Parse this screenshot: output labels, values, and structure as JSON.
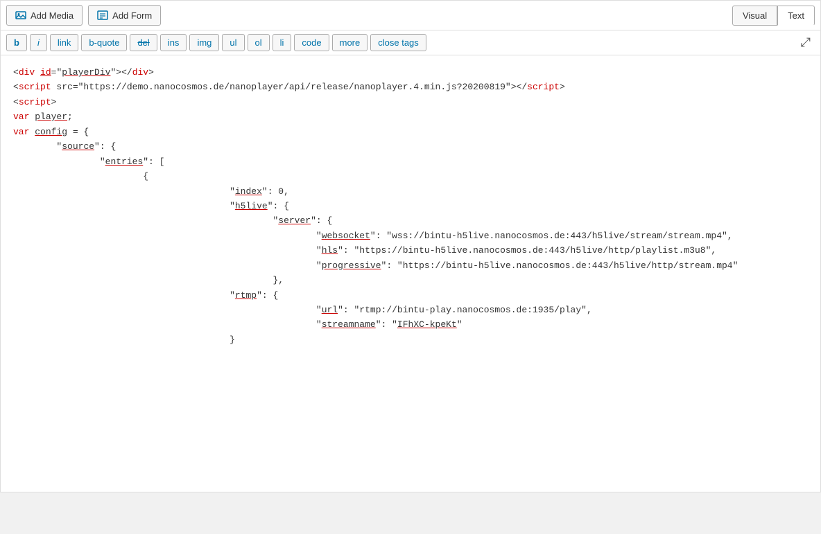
{
  "topToolbar": {
    "addMediaLabel": "Add Media",
    "addFormLabel": "Add Form",
    "visualLabel": "Visual",
    "textLabel": "Text"
  },
  "formatToolbar": {
    "buttons": [
      {
        "label": "b",
        "style": "bold"
      },
      {
        "label": "i",
        "style": "italic"
      },
      {
        "label": "link",
        "style": "normal"
      },
      {
        "label": "b-quote",
        "style": "normal"
      },
      {
        "label": "del",
        "style": "strikethrough"
      },
      {
        "label": "ins",
        "style": "normal"
      },
      {
        "label": "img",
        "style": "normal"
      },
      {
        "label": "ul",
        "style": "normal"
      },
      {
        "label": "ol",
        "style": "normal"
      },
      {
        "label": "li",
        "style": "normal"
      },
      {
        "label": "code",
        "style": "normal"
      },
      {
        "label": "more",
        "style": "normal"
      },
      {
        "label": "close tags",
        "style": "normal"
      }
    ],
    "expandIcon": "⤢"
  },
  "codeContent": {
    "line1": "<div id=\"playerDiv\"></div>",
    "line2": "<script src=\"https://demo.nanocosmos.de/nanoplayer/api/release/nanoplayer.4.min.js?20200819\"><\\/script>",
    "line3": "<script>",
    "line4": "var player;",
    "line5": "var config = {",
    "line6": "        \"source\": {",
    "line7": "                \"entries\": [",
    "line8": "                        {",
    "line9": "                                        \"index\": 0,",
    "line10": "                                        \"h5live\": {",
    "line11": "                                                \"server\": {",
    "line12a": "                                                        \"websocket\": \"wss://bintu-",
    "line12b": "h5live.nanocosmos.de:443/h5live/stream/stream.mp4\",",
    "line13a": "                                                        \"hls\": \"https://bintu-",
    "line13b": "h5live.nanocosmos.de:443/h5live/http/playlist.m3u8\",",
    "line14a": "                                                        \"progressive\": \"https://bintu-",
    "line14b": "h5live.nanocosmos.de:443/h5live/http/stream.mp4\"",
    "line15": "                                                },",
    "line16": "                                        \"rtmp\": {",
    "line17": "                                                        \"url\": \"rtmp://bintu-play.nanocosmos.de:1935/play\",",
    "line18": "                                                        \"streamname\": \"IFhXC-kpeKt\"",
    "line19": "                                        }"
  }
}
